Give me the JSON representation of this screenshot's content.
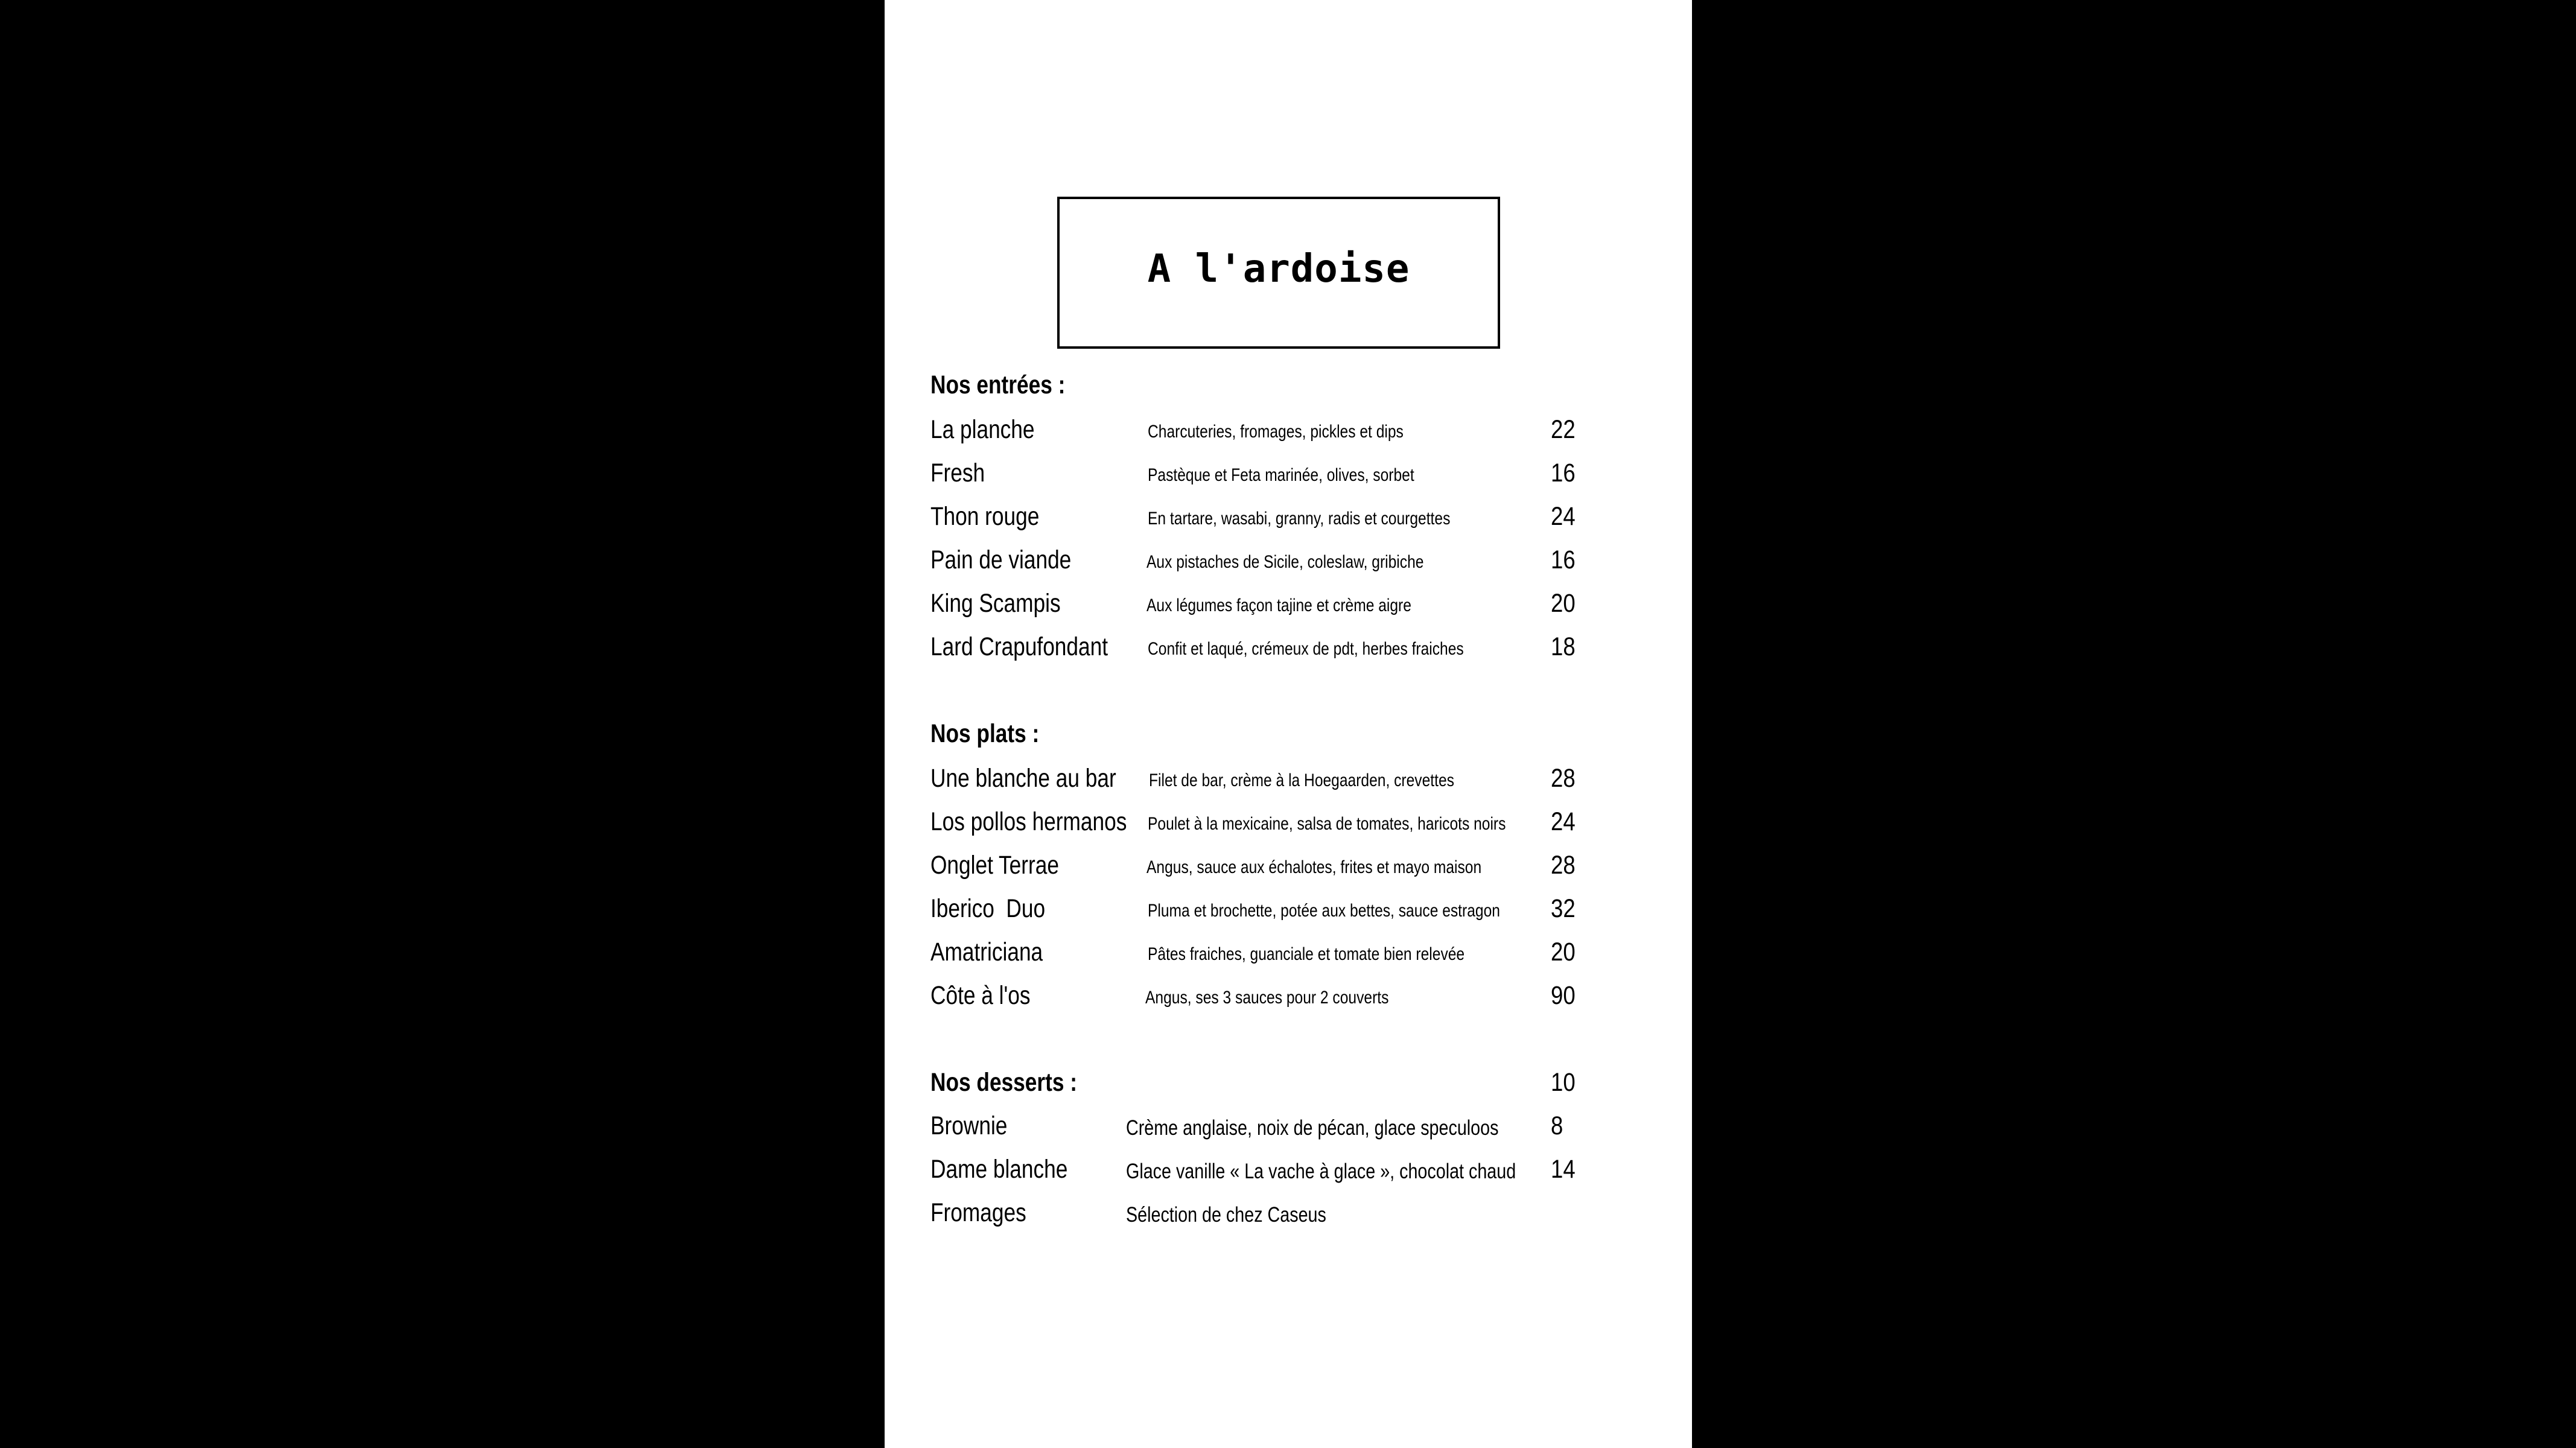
{
  "title": "A l'ardoise",
  "sections": {
    "entrees": {
      "heading": "Nos entrées :",
      "items": [
        {
          "name": "La planche",
          "description": "Charcuteries, fromages, pickles et dips",
          "price": "22"
        },
        {
          "name": "Fresh",
          "description": "Pastèque et Feta marinée, olives, sorbet",
          "price": "16"
        },
        {
          "name": "Thon rouge",
          "description": "En tartare, wasabi, granny, radis et courgettes",
          "price": "24"
        },
        {
          "name": "Pain de viande",
          "description": "Aux pistaches de Sicile, coleslaw, gribiche",
          "price": "16"
        },
        {
          "name": "King Scampis",
          "description": "Aux légumes façon tajine et crème aigre",
          "price": "20"
        },
        {
          "name": "Lard Crapufondant",
          "description": "Confit et laqué, crémeux de pdt, herbes fraiches",
          "price": "18"
        }
      ]
    },
    "plats": {
      "heading": "Nos plats :",
      "items": [
        {
          "name": "Une blanche au bar",
          "description": "Filet de bar, crème à la Hoegaarden, crevettes",
          "price": "28"
        },
        {
          "name": "Los pollos hermanos",
          "description": "Poulet à la mexicaine, salsa de tomates, haricots noirs",
          "price": "24"
        },
        {
          "name": "Onglet Terrae",
          "description": "Angus, sauce aux échalotes, frites et mayo maison",
          "price": "28"
        },
        {
          "name": "Iberico  Duo",
          "description": "Pluma et brochette, potée aux bettes, sauce estragon",
          "price": "32"
        },
        {
          "name": "Amatriciana",
          "description": "Pâtes fraiches, guanciale et tomate bien relevée",
          "price": "20"
        },
        {
          "name": "Côte à l'os",
          "description": "Angus, ses 3 sauces pour 2 couverts",
          "price": "90"
        }
      ]
    },
    "desserts": {
      "heading": "Nos desserts :",
      "heading_price": "10",
      "items": [
        {
          "name": "Brownie",
          "description": "Crème anglaise, noix de pécan, glace speculoos",
          "price": "8"
        },
        {
          "name": "Dame blanche",
          "description": "Glace vanille « La vache à glace », chocolat chaud",
          "price": "14"
        },
        {
          "name": "Fromages",
          "description": "Sélection de chez Caseus",
          "price": ""
        }
      ]
    }
  }
}
